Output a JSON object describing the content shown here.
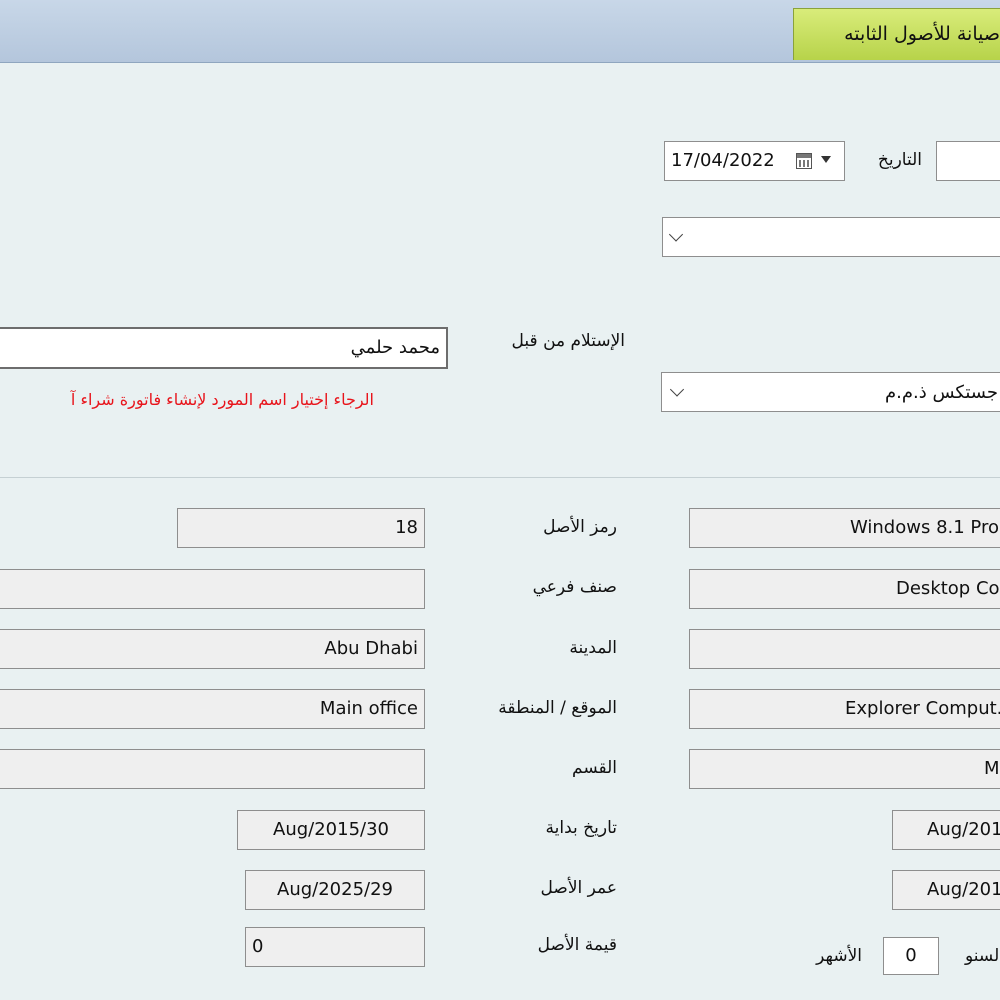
{
  "window": {
    "tab_title": "صيانة للأصول الثابته"
  },
  "header": {
    "date_label": "التاريخ",
    "date_value": "17/04/2022",
    "received_by_label": "الإستلام من قبل",
    "received_by_value": "محمد حلمي",
    "supplier_value": "جستكس ذ.م.م",
    "warning": "الرجاء إختيار اسم المورد لإنشاء فاتورة شراء آ"
  },
  "asset": {
    "asset_code_label": "رمز الأصل",
    "asset_code_value": "18",
    "subclass_label": "صنف فرعي",
    "subclass_value": "",
    "city_label": "المدينة",
    "city_value": "Abu Dhabi",
    "location_label": "الموقع / المنطقة",
    "location_value": "Main office",
    "department_label": "القسم",
    "department_value": "",
    "start_date_label": "تاريخ بداية",
    "start_date_value": "Aug/2015/30",
    "asset_life_label": "عمر الأصل",
    "asset_life_value": "Aug/2025/29",
    "asset_value_label": "قيمة الأصل",
    "asset_value_value": "0",
    "right_col": {
      "name_value": "Windows 8.1 Pro",
      "class_value": "Desktop Co",
      "city_value": "",
      "vendor_value": "Explorer Comput.",
      "dept_value": "M",
      "date1_value": "Aug/201",
      "date2_value": "Aug/201",
      "years_label": "السنو",
      "months_label": "الأشهر",
      "months_value": "0"
    }
  }
}
